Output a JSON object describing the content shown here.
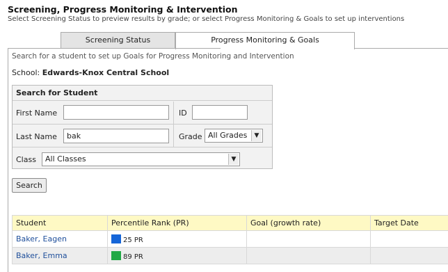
{
  "header": {
    "title": "Screening, Progress Monitoring & Intervention",
    "subtitle": "Select Screening Status to preview results by grade; or select Progress Monitoring & Goals to set up interventions"
  },
  "tabs": [
    {
      "label": "Screening Status",
      "active": false
    },
    {
      "label": "Progress Monitoring & Goals",
      "active": true
    }
  ],
  "panel": {
    "instructions": "Search for a student to set up Goals for Progress Monitoring and Intervention",
    "school_label": "School:",
    "school_name": "Edwards-Knox Central School"
  },
  "search": {
    "header": "Search for Student",
    "first_name_label": "First Name",
    "first_name_value": "",
    "id_label": "ID",
    "id_value": "",
    "last_name_label": "Last Name",
    "last_name_value": "bak",
    "grade_label": "Grade",
    "grade_value": "All Grades",
    "class_label": "Class",
    "class_value": "All Classes",
    "button_label": "Search"
  },
  "results": {
    "columns": [
      "Student",
      "Percentile Rank (PR)",
      "Goal (growth rate)",
      "Target Date"
    ],
    "rows": [
      {
        "student": "Baker, Eagen",
        "pr": "25 PR",
        "pr_color": "#1565d8",
        "goal": "",
        "target_date": ""
      },
      {
        "student": "Baker, Emma",
        "pr": "89 PR",
        "pr_color": "#22a846",
        "goal": "",
        "target_date": ""
      }
    ]
  },
  "colors": {
    "header_row_bg": "#fef9c4",
    "link": "#1f4f9b",
    "tab_inactive_bg": "#e4e4e4"
  }
}
